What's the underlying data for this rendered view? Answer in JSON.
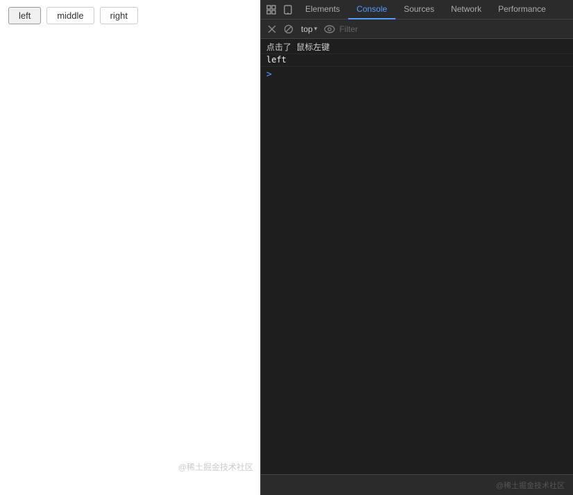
{
  "left_panel": {
    "buttons": [
      {
        "label": "left",
        "id": "left",
        "active": true
      },
      {
        "label": "middle",
        "id": "middle",
        "active": false
      },
      {
        "label": "right",
        "id": "right",
        "active": false
      }
    ],
    "watermark": "@稀土掘金技术社区"
  },
  "devtools": {
    "tabs": [
      {
        "label": "Elements",
        "active": false
      },
      {
        "label": "Console",
        "active": true
      },
      {
        "label": "Sources",
        "active": false
      },
      {
        "label": "Network",
        "active": false
      },
      {
        "label": "Performance",
        "active": false
      }
    ],
    "toolbar2": {
      "top_label": "top",
      "filter_placeholder": "Filter"
    },
    "console_lines": [
      {
        "type": "info",
        "text": "点击了 鼠标左键"
      },
      {
        "type": "output",
        "text": "left"
      }
    ],
    "prompt_arrow": ">"
  }
}
